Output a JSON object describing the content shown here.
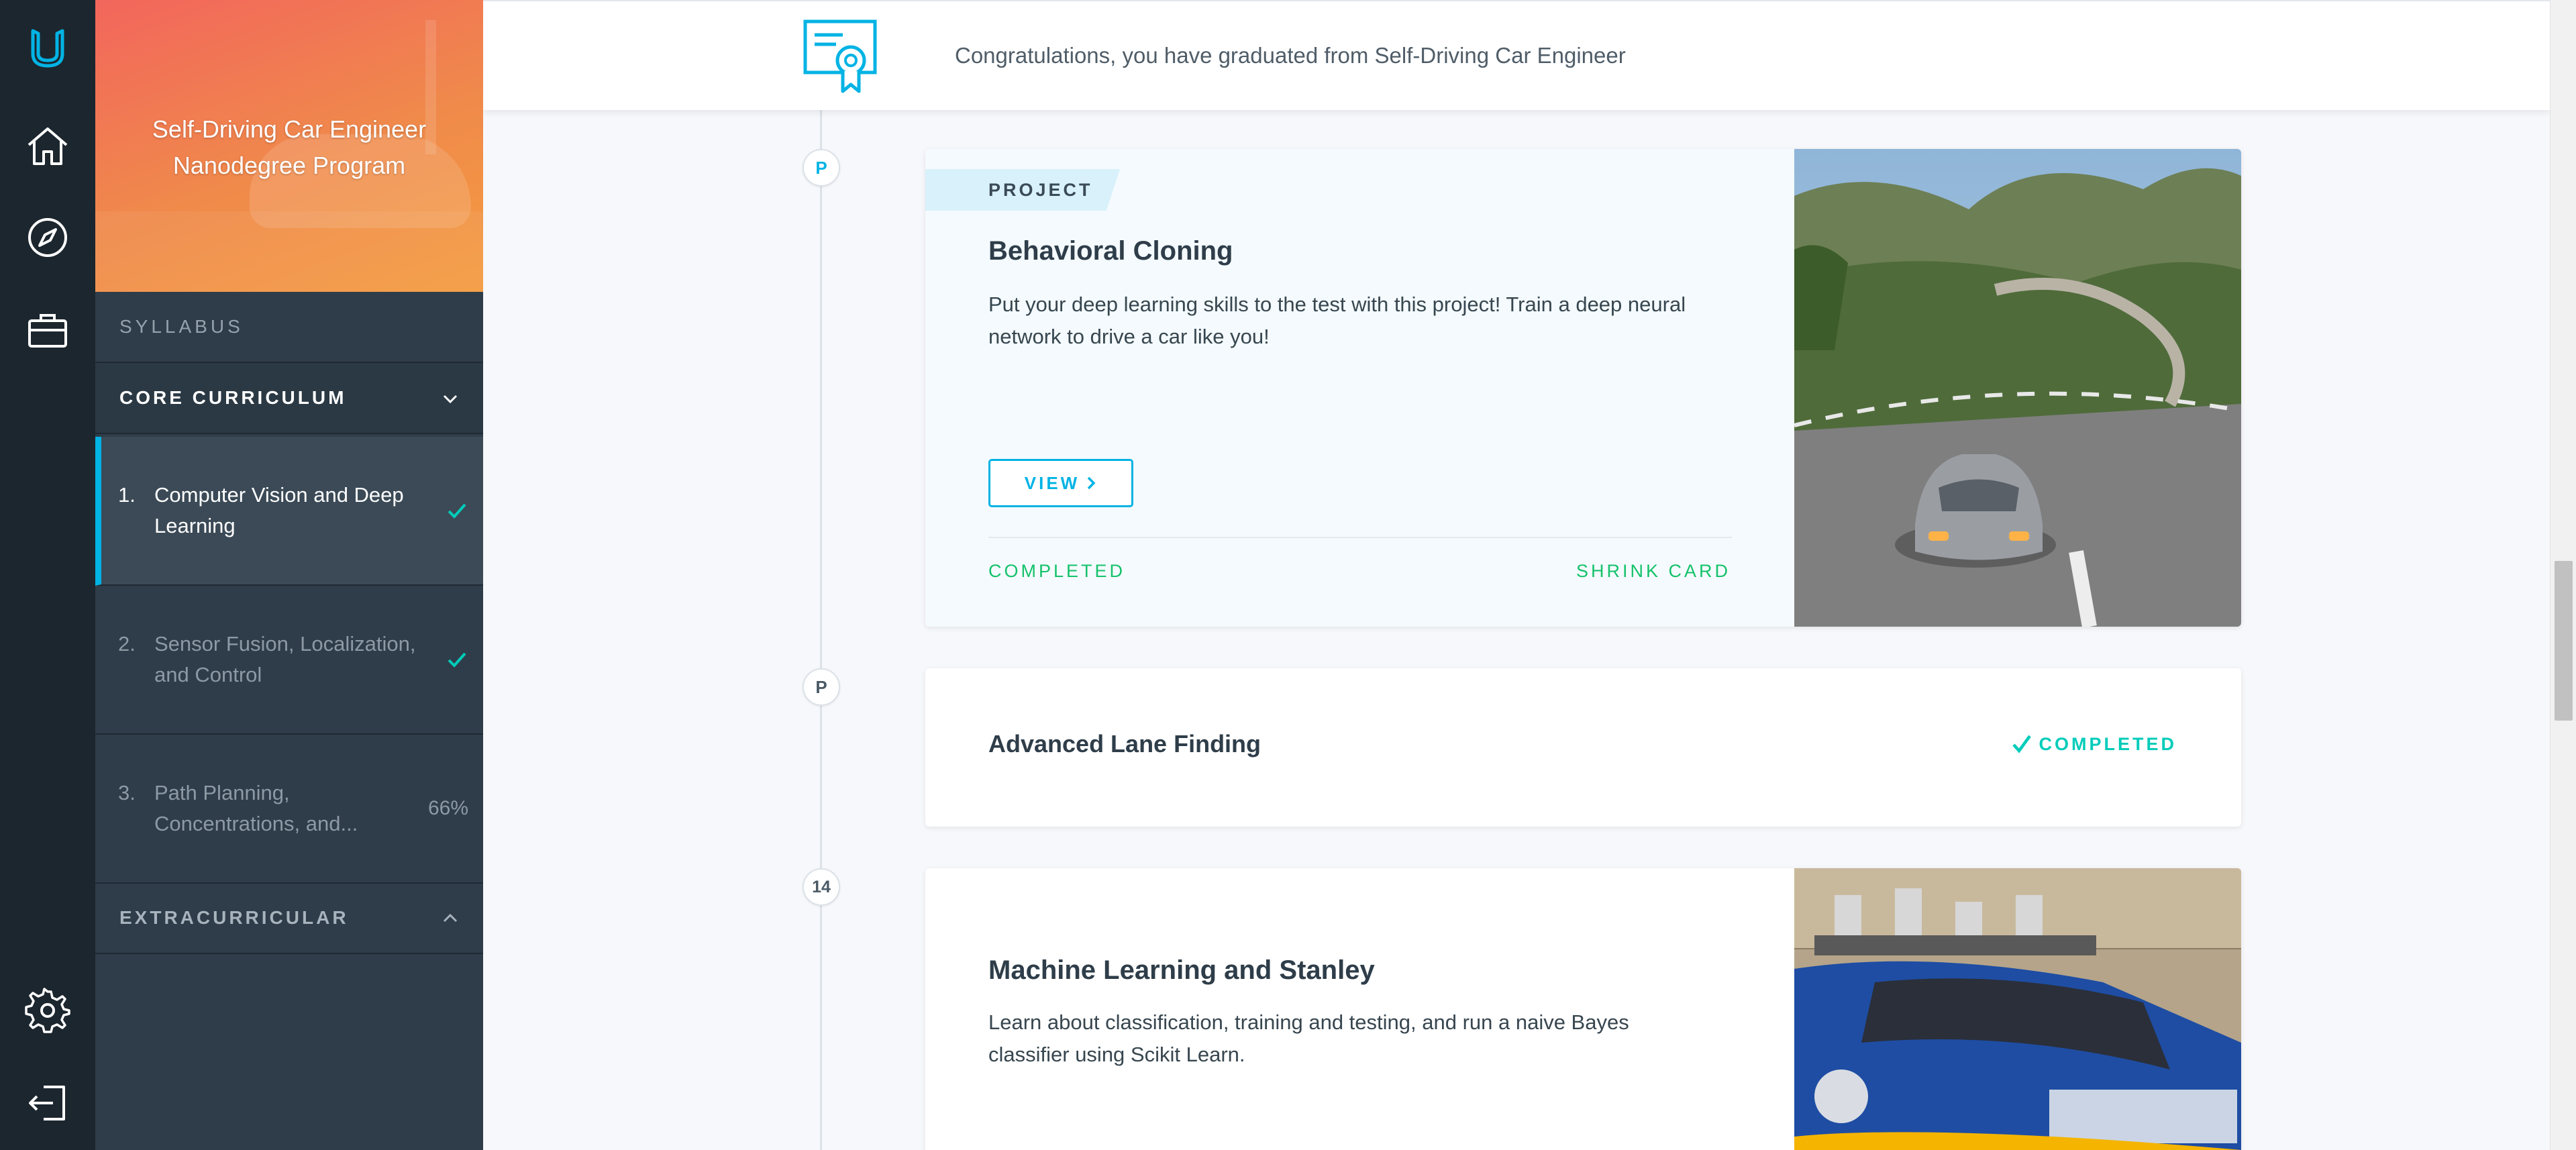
{
  "rail": {
    "icons": [
      "udacity-logo-icon",
      "home-icon",
      "compass-icon",
      "briefcase-icon",
      "gear-icon",
      "logout-icon"
    ]
  },
  "sidebar": {
    "program_title_line1": "Self-Driving Car Engineer",
    "program_title_line2": "Nanodegree Program",
    "syllabus_label": "SYLLABUS",
    "core_label": "CORE CURRICULUM",
    "extra_label": "EXTRACURRICULAR",
    "lessons": [
      {
        "number": "1.",
        "title": "Computer Vision and Deep Learning",
        "status": "check",
        "active": true
      },
      {
        "number": "2.",
        "title": "Sensor Fusion, Localization, and Control",
        "status": "check",
        "active": false
      },
      {
        "number": "3.",
        "title": "Path Planning, Concentrations, and...",
        "status": "66%",
        "active": false
      }
    ]
  },
  "banner": {
    "text": "Congratulations, you have graduated from Self-Driving Car Engineer"
  },
  "timeline": {
    "markers": [
      "P",
      "P",
      "14"
    ]
  },
  "cards": {
    "behavioral_cloning": {
      "tag": "PROJECT",
      "title": "Behavioral Cloning",
      "description": "Put your deep learning skills to the test with this project! Train a deep neural network to drive a car like you!",
      "view_label": "VIEW",
      "status": "COMPLETED",
      "shrink_label": "SHRINK CARD"
    },
    "advanced_lane": {
      "title": "Advanced Lane Finding",
      "status": "COMPLETED"
    },
    "ml_stanley": {
      "title": "Machine Learning and Stanley",
      "description": "Learn about classification, training and testing, and run a naive Bayes classifier using Scikit Learn."
    }
  },
  "colors": {
    "accent": "#02b3e4",
    "success": "#15c26b",
    "teal": "#02ccba",
    "sidebar_bg": "#2e3d49",
    "rail_bg": "#1c262f"
  }
}
